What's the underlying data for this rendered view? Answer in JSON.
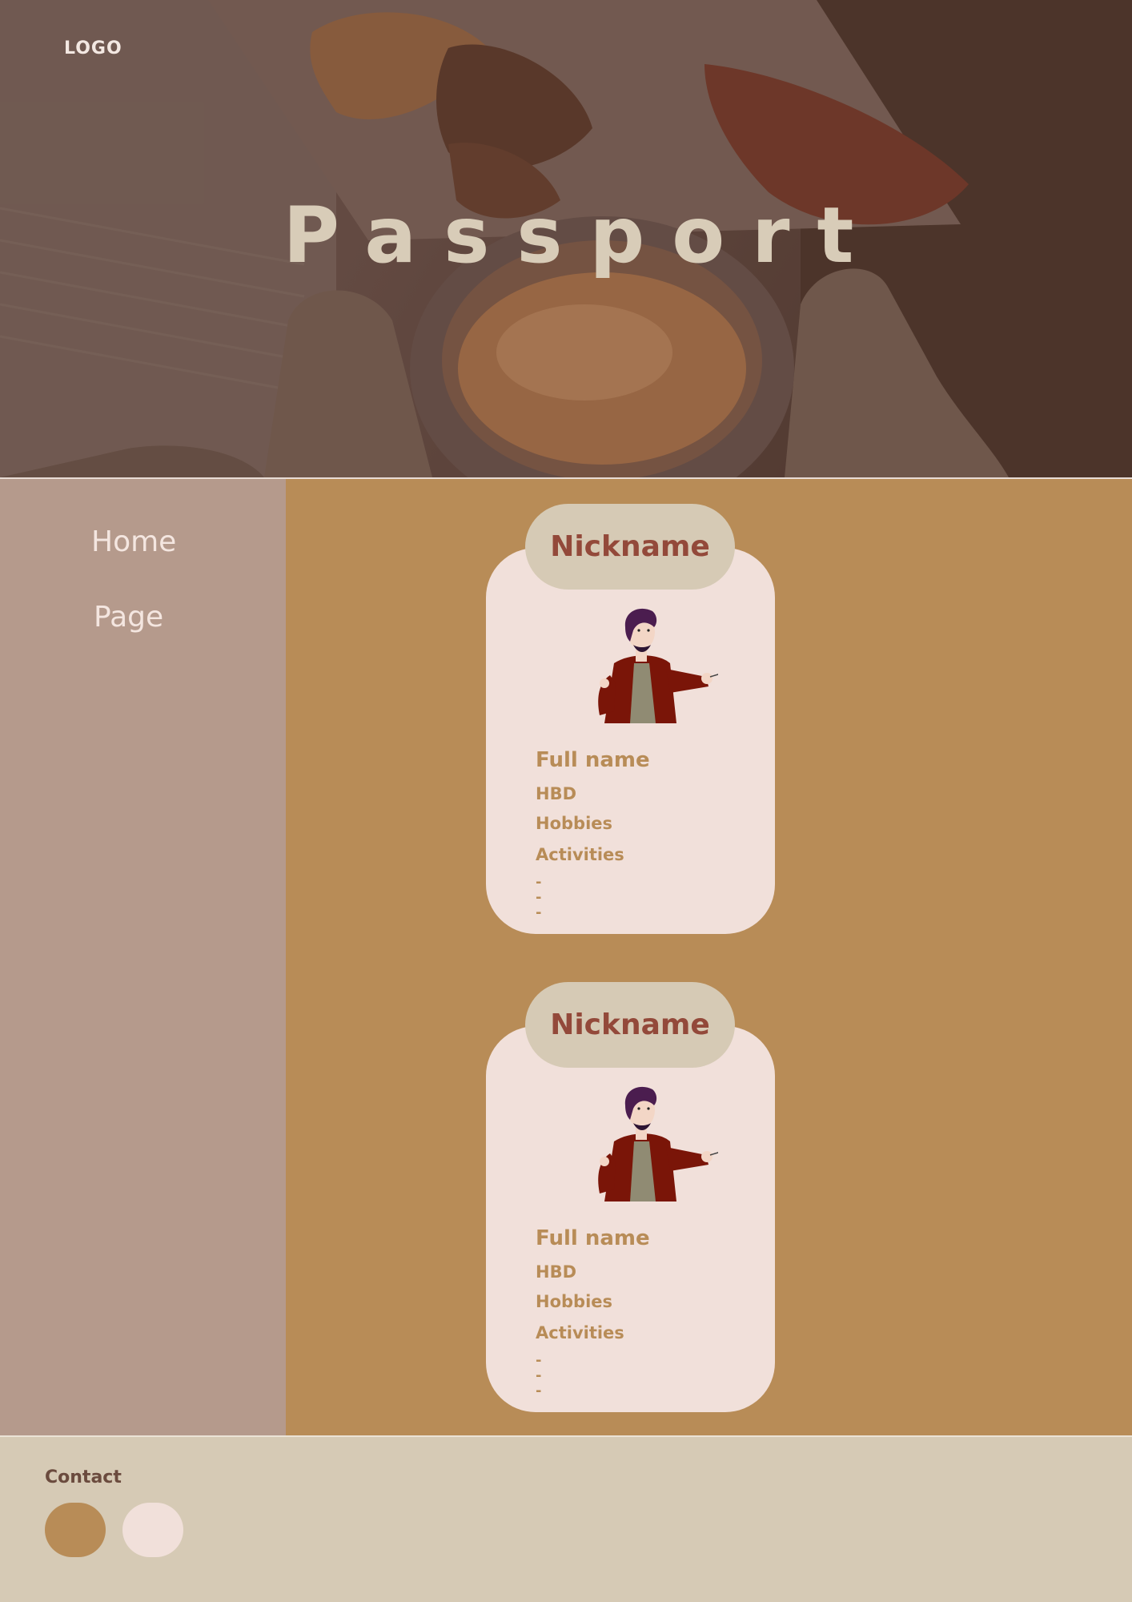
{
  "header": {
    "logo": "LOGO",
    "title": "Passport"
  },
  "sidebar": {
    "items": [
      {
        "label": "Home"
      },
      {
        "label": "Page"
      }
    ]
  },
  "cards": [
    {
      "nickname": "Nickname",
      "full_name": "Full name",
      "hbd": "HBD",
      "hobbies": "Hobbies",
      "activities": "Activities",
      "activity_items": [
        "-",
        "-",
        "-"
      ],
      "avatar_icon": "man-pointing-illustration"
    },
    {
      "nickname": "Nickname",
      "full_name": "Full name",
      "hbd": "HBD",
      "hobbies": "Hobbies",
      "activities": "Activities",
      "activity_items": [
        "-",
        "-",
        "-"
      ],
      "avatar_icon": "man-pointing-illustration"
    }
  ],
  "footer": {
    "contact_label": "Contact",
    "contact_buttons": [
      "contact-button-1",
      "contact-button-2"
    ]
  },
  "colors": {
    "sidebar": "#b59a8c",
    "main": "#b88c57",
    "card": "#f1e0da",
    "pill": "#d6cab5",
    "nickname_text": "#93493a",
    "footer": "#d6cab5"
  }
}
